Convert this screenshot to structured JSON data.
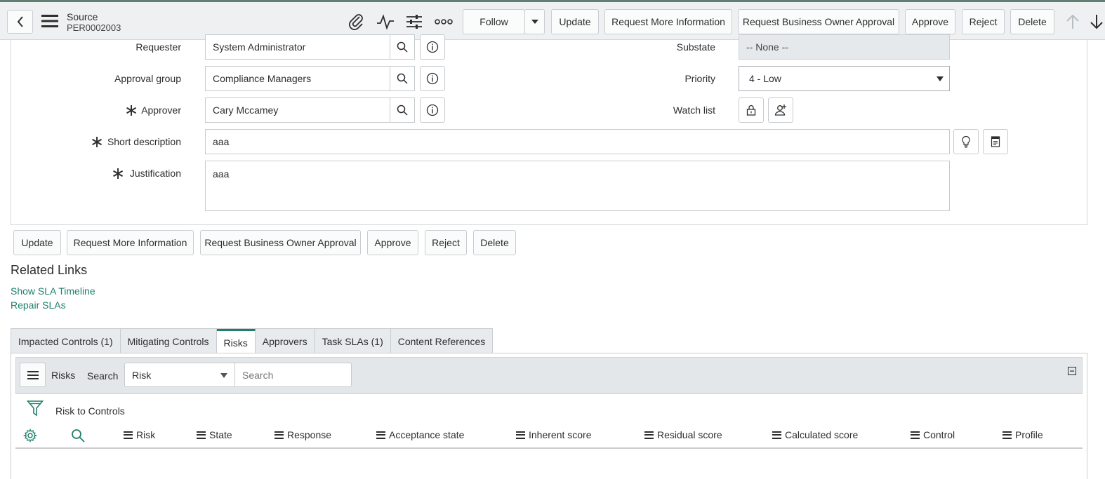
{
  "header": {
    "title": "Source",
    "record_number": "PER0002003",
    "follow_label": "Follow",
    "buttons": [
      "Update",
      "Request More Information",
      "Request Business Owner Approval",
      "Approve",
      "Reject",
      "Delete"
    ]
  },
  "form": {
    "requester": {
      "label": "Requester",
      "value": "System Administrator"
    },
    "approval_group": {
      "label": "Approval group",
      "value": "Compliance Managers"
    },
    "approver": {
      "label": "Approver",
      "value": "Cary Mccamey"
    },
    "short_description": {
      "label": "Short description",
      "value": "aaa"
    },
    "justification": {
      "label": "Justification",
      "value": "aaa"
    },
    "substate": {
      "label": "Substate",
      "value": "-- None --"
    },
    "priority": {
      "label": "Priority",
      "value": "4 - Low"
    },
    "watch_list": {
      "label": "Watch list"
    },
    "required_marker": "∗"
  },
  "bottom_buttons": [
    "Update",
    "Request More Information",
    "Request Business Owner Approval",
    "Approve",
    "Reject",
    "Delete"
  ],
  "related_links": {
    "title": "Related Links",
    "links": [
      "Show SLA Timeline",
      "Repair SLAs"
    ]
  },
  "tabs": [
    {
      "label": "Impacted Controls (1)",
      "active": false
    },
    {
      "label": "Mitigating Controls",
      "active": false
    },
    {
      "label": "Risks",
      "active": true
    },
    {
      "label": "Approvers",
      "active": false
    },
    {
      "label": "Task SLAs (1)",
      "active": false
    },
    {
      "label": "Content References",
      "active": false
    }
  ],
  "list": {
    "title": "Risks",
    "search_label": "Search",
    "search_field": "Risk",
    "search_placeholder": "Search",
    "filter_text": "Risk to Controls",
    "columns": [
      "Risk",
      "State",
      "Response",
      "Acceptance state",
      "Inherent score",
      "Residual score",
      "Calculated score",
      "Control",
      "Profile"
    ]
  },
  "colors": {
    "accent": "#1f7f6b",
    "header_bg": "#eef0f1",
    "top_line": "#5f7f72"
  }
}
